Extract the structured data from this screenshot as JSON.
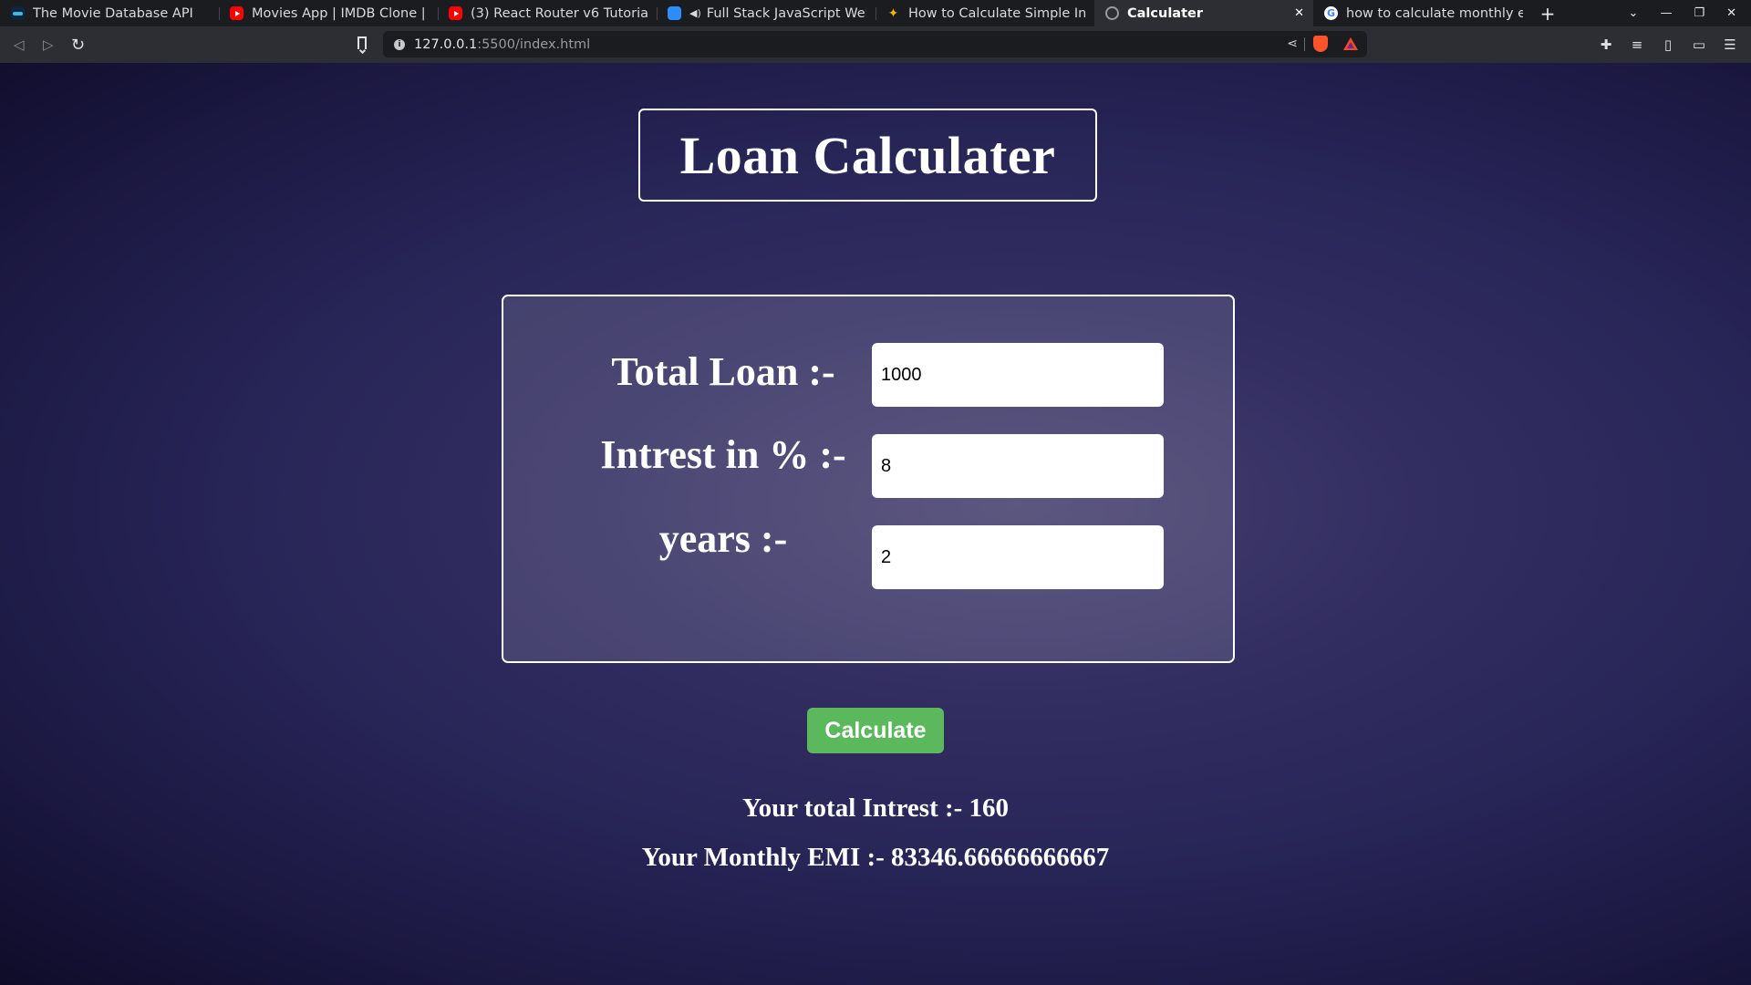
{
  "browser": {
    "tabs": [
      {
        "title": "The Movie Database API",
        "favicon": "tmdb-icon"
      },
      {
        "title": "Movies App | IMDB Clone | React",
        "favicon": "youtube-icon"
      },
      {
        "title": "(3) React Router v6 Tutorial in",
        "favicon": "youtube-icon"
      },
      {
        "title": "Full Stack JavaScript Web D",
        "favicon": "zoom-icon",
        "audio": true
      },
      {
        "title": "How to Calculate Simple Inter",
        "favicon": "spark-icon"
      },
      {
        "title": "Calculater",
        "favicon": "globe-icon",
        "active": true
      },
      {
        "title": "how to calculate monthly emi",
        "favicon": "google-icon"
      }
    ],
    "url": {
      "host": "127.0.0.1",
      "rest": ":5500/index.html"
    }
  },
  "page": {
    "title": "Loan Calculater",
    "fields": [
      {
        "label": "Total Loan :-",
        "value": "1000"
      },
      {
        "label": "Intrest in % :-",
        "value": "8"
      },
      {
        "label": "years :-",
        "value": "2"
      }
    ],
    "calculate_label": "Calculate",
    "results": {
      "interest_text": "Your total Intrest :- 160",
      "emi_text": "Your Monthly EMI :- 83346.66666666667"
    }
  },
  "colors": {
    "background_dark": "#0f0c29",
    "background_mid": "#302b63",
    "button_green": "#5cb85c",
    "browser_chrome": "#2d2e33"
  }
}
